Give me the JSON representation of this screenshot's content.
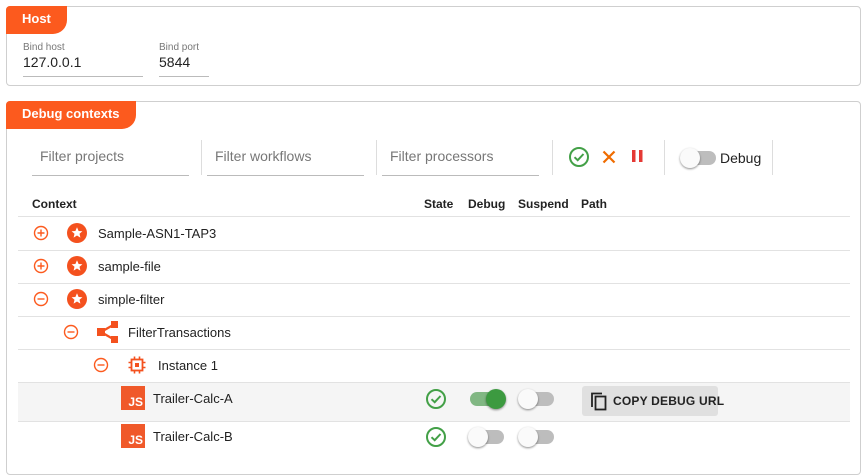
{
  "host": {
    "title": "Host",
    "bind_host_label": "Bind host",
    "bind_host_value": "127.0.0.1",
    "bind_port_label": "Bind port",
    "bind_port_value": "5844"
  },
  "debug": {
    "title": "Debug contexts",
    "filters": {
      "projects_placeholder": "Filter projects",
      "workflows_placeholder": "Filter workflows",
      "processors_placeholder": "Filter processors"
    },
    "toolbar": {
      "debug_toggle_label": "Debug",
      "debug_toggle_on": false
    },
    "columns": {
      "context": "Context",
      "state": "State",
      "debug": "Debug",
      "suspend": "Suspend",
      "path": "Path"
    },
    "tree": {
      "projects": [
        "Sample-ASN1-TAP3",
        "sample-file",
        "simple-filter"
      ],
      "workflow": "FilterTransactions",
      "instance": "Instance 1",
      "processors": [
        {
          "name": "Trailer-Calc-A",
          "badge": "JS",
          "debug_on": true,
          "suspend_on": false,
          "copy_label": "COPY DEBUG URL"
        },
        {
          "name": "Trailer-Calc-B",
          "badge": "JS",
          "debug_on": false,
          "suspend_on": false
        }
      ]
    },
    "colors": {
      "accent": "#fc5a1e",
      "ok": "#43a047",
      "cancel": "#ef6c00",
      "pause": "#e53935"
    }
  }
}
